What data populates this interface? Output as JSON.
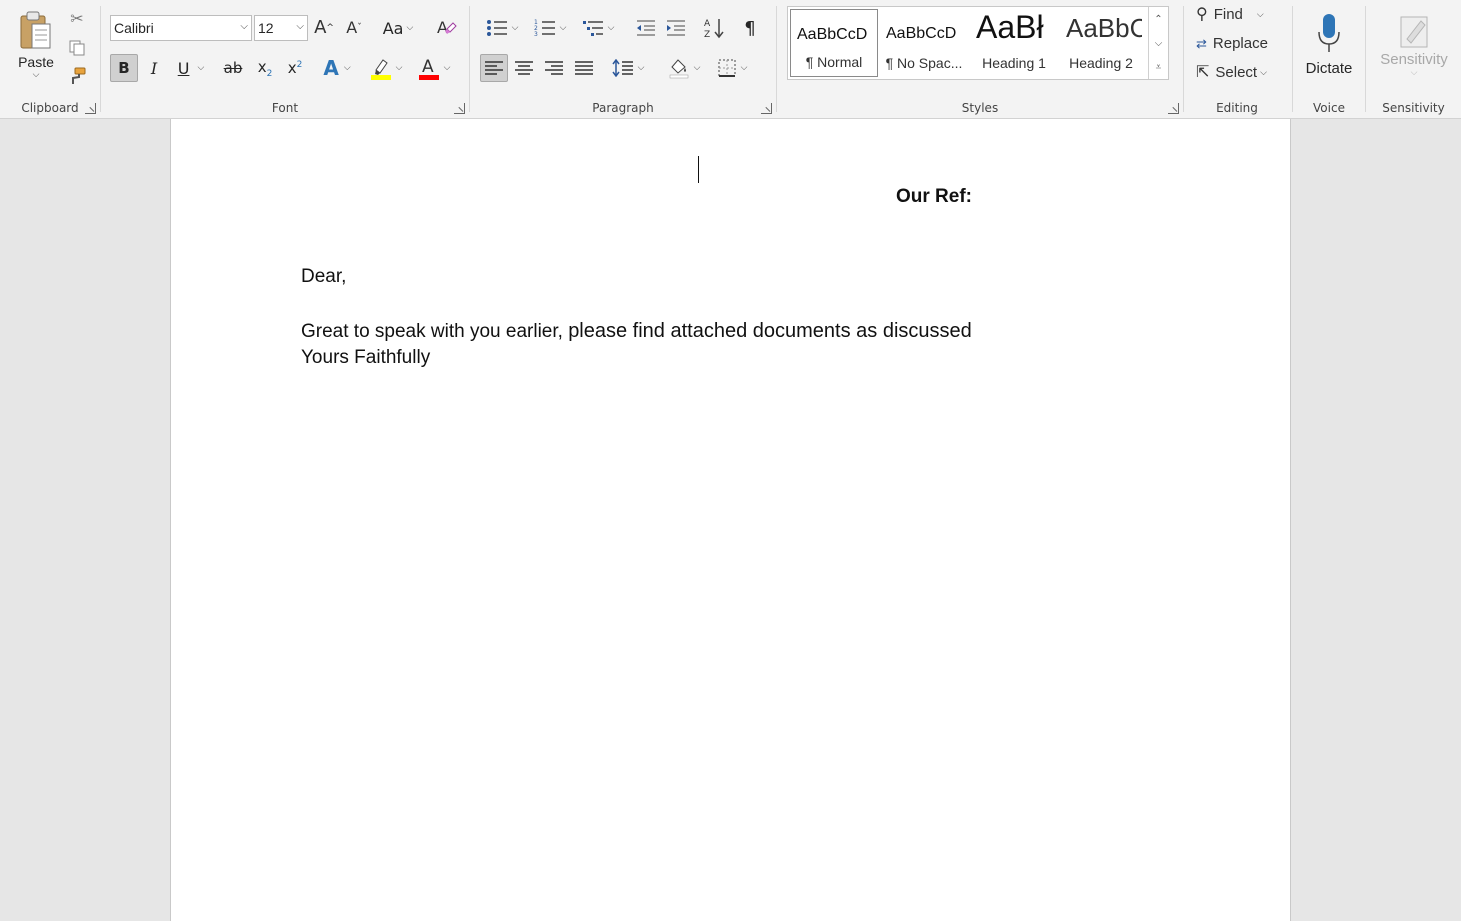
{
  "ribbon": {
    "clipboard": {
      "label": "Clipboard",
      "paste_label": "Paste"
    },
    "font": {
      "label": "Font",
      "font_name": "Calibri",
      "font_size": "12",
      "bold": "B",
      "italic": "I",
      "underline": "U",
      "strike": "ab",
      "subscript": "x",
      "subscript_mark": "2",
      "superscript": "x",
      "superscript_mark": "2",
      "grow": "A",
      "shrink": "A",
      "change_case": "Aa",
      "highlight_color": "#ffff00",
      "font_color": "#ff0000"
    },
    "paragraph": {
      "label": "Paragraph",
      "pilcrow": "¶"
    },
    "styles": {
      "label": "Styles",
      "items": [
        {
          "sample": "AaBbCcD",
          "name": "¶ Normal"
        },
        {
          "sample": "AaBbCcD",
          "name": "¶ No Spac..."
        },
        {
          "sample": "AaBł",
          "name": "Heading 1"
        },
        {
          "sample": "AaBbC",
          "name": "Heading 2"
        }
      ]
    },
    "editing": {
      "label": "Editing",
      "find": "Find",
      "replace": "Replace",
      "select": "Select"
    },
    "voice": {
      "label": "Voice",
      "dictate": "Dictate"
    },
    "sensitivity": {
      "label": "Sensitivity",
      "button": "Sensitivity"
    }
  },
  "document": {
    "our_ref": "Our Ref:",
    "salutation": "Dear,",
    "body_a": "Great to speak with you earlier, ",
    "body_b": "please find attached documents as discussed",
    "closing": "Yours Faithfully"
  },
  "colors": {
    "accent": "#2b579a",
    "highlight": "#ffff00",
    "font_red": "#ff0000",
    "text_effect_blue": "#2e75b6"
  }
}
